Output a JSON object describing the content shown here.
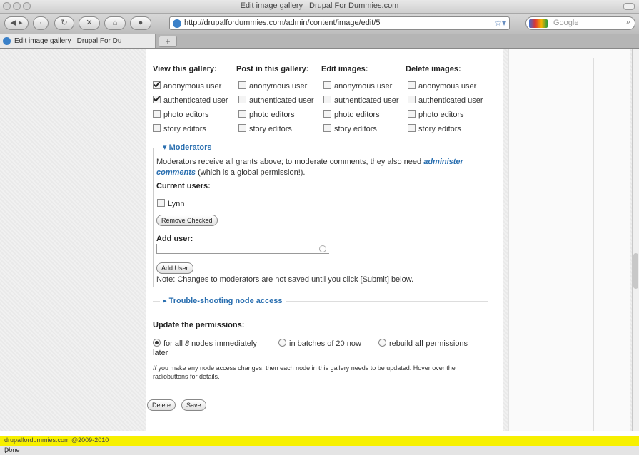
{
  "window": {
    "title": "Edit image gallery | Drupal For Dummies.com"
  },
  "toolbar": {
    "url": "http://drupalfordummies.com/admin/content/image/edit/5",
    "search_placeholder": "Google"
  },
  "tabs": [
    {
      "label": "Edit image gallery | Drupal For Du"
    }
  ],
  "permissions": {
    "headers": [
      "View this gallery:",
      "Post in this gallery:",
      "Edit images:",
      "Delete images:"
    ],
    "rows": [
      {
        "label": "anonymous user",
        "checked": [
          true,
          false,
          false,
          false
        ]
      },
      {
        "label": "authenticated user",
        "checked": [
          true,
          false,
          false,
          false
        ]
      },
      {
        "label": "photo editors",
        "checked": [
          false,
          false,
          false,
          false
        ]
      },
      {
        "label": "story editors",
        "checked": [
          false,
          false,
          false,
          false
        ]
      }
    ]
  },
  "moderators": {
    "legend": "Moderators",
    "desc_pre": "Moderators receive all grants above; to moderate comments, they also need ",
    "desc_link": "administer comments",
    "desc_post": " (which is a global permission!).",
    "current_users_label": "Current users:",
    "users": [
      "Lynn"
    ],
    "remove_button": "Remove Checked",
    "add_user_label": "Add user:",
    "add_user_value": "",
    "add_button": "Add User",
    "note": "Note: Changes to moderators are not saved until you click [Submit] below."
  },
  "troubleshooting": {
    "label": "Trouble-shooting node access"
  },
  "update": {
    "heading": "Update the permissions:",
    "opt1_pre": "for all ",
    "opt1_num": "8",
    "opt1_post": " nodes immediately",
    "opt2": "in batches of 20 now",
    "opt3_pre": "rebuild ",
    "opt3_bold": "all",
    "opt3_post": " permissions",
    "later": "later",
    "help_em": "If",
    "help": " you make any node access changes, then each node in this gallery needs to be updated. Hover over the radiobuttons for details."
  },
  "buttons": {
    "delete": "Delete",
    "save": "Save"
  },
  "footer": {
    "text": "drupalfordummies.com @2009-2010"
  },
  "status": {
    "text": "Done"
  }
}
